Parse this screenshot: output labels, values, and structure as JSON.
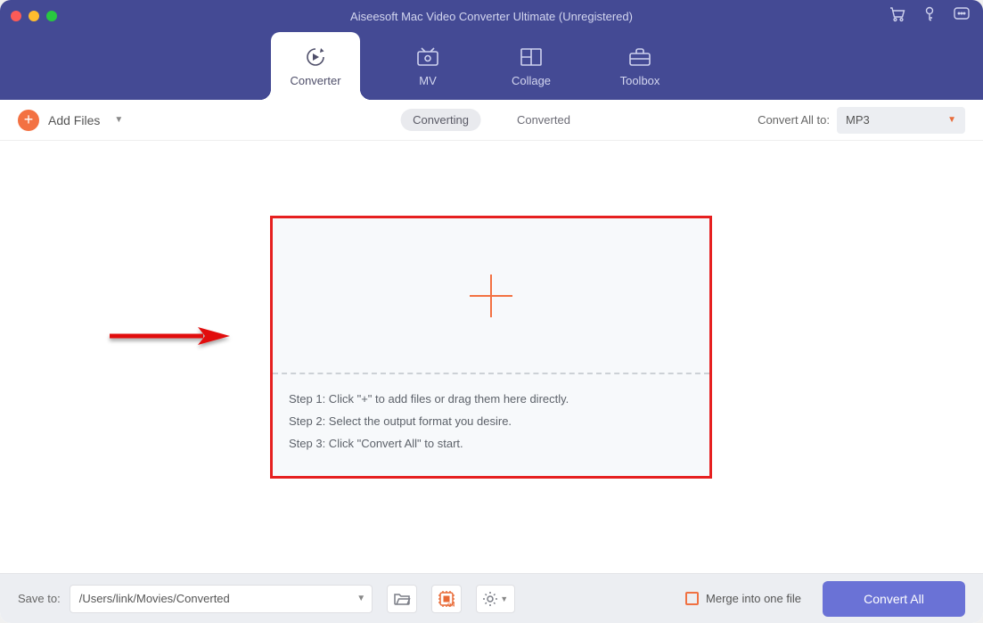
{
  "title": "Aiseesoft Mac Video Converter Ultimate (Unregistered)",
  "tabs": {
    "converter": "Converter",
    "mv": "MV",
    "collage": "Collage",
    "toolbox": "Toolbox"
  },
  "toolbar": {
    "add_files": "Add Files",
    "converting": "Converting",
    "converted": "Converted",
    "convert_all_to": "Convert All to:",
    "selected_format": "MP3"
  },
  "drop": {
    "step1": "Step 1: Click \"+\" to add files or drag them here directly.",
    "step2": "Step 2: Select the output format you desire.",
    "step3": "Step 3: Click \"Convert All\" to start."
  },
  "footer": {
    "save_to": "Save to:",
    "path": "/Users/link/Movies/Converted",
    "merge": "Merge into one file",
    "convert_all": "Convert All"
  }
}
